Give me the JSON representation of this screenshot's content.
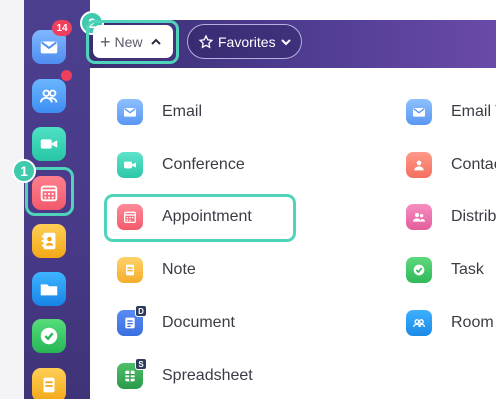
{
  "sidebar": {
    "mail_badge": "14",
    "apps": [
      "mail-icon",
      "contacts-icon",
      "video-icon",
      "calendar-icon",
      "address-book-icon",
      "folder-icon",
      "check-icon",
      "notes-icon"
    ]
  },
  "steps": {
    "step1": "1",
    "step2": "2"
  },
  "toolbar": {
    "new_label": "New",
    "favorites_label": "Favorites"
  },
  "menu": {
    "left": [
      {
        "label": "Email",
        "icon": "email-icon"
      },
      {
        "label": "Conference",
        "icon": "video-icon"
      },
      {
        "label": "Appointment",
        "icon": "calendar-icon"
      },
      {
        "label": "Note",
        "icon": "note-icon"
      },
      {
        "label": "Document",
        "icon": "document-icon",
        "badge": "D"
      },
      {
        "label": "Spreadsheet",
        "icon": "spreadsheet-icon",
        "badge": "S"
      }
    ],
    "right": [
      {
        "label": "Email T",
        "icon": "email-template-icon"
      },
      {
        "label": "Contac",
        "icon": "contact-icon"
      },
      {
        "label": "Distrib",
        "icon": "distribution-list-icon"
      },
      {
        "label": "Task",
        "icon": "task-icon"
      },
      {
        "label": "Room",
        "icon": "room-icon"
      }
    ]
  },
  "colors": {
    "highlight": "#4fd3bb",
    "sidebar": "#4b3f8e",
    "badge": "#ef3f5c"
  }
}
